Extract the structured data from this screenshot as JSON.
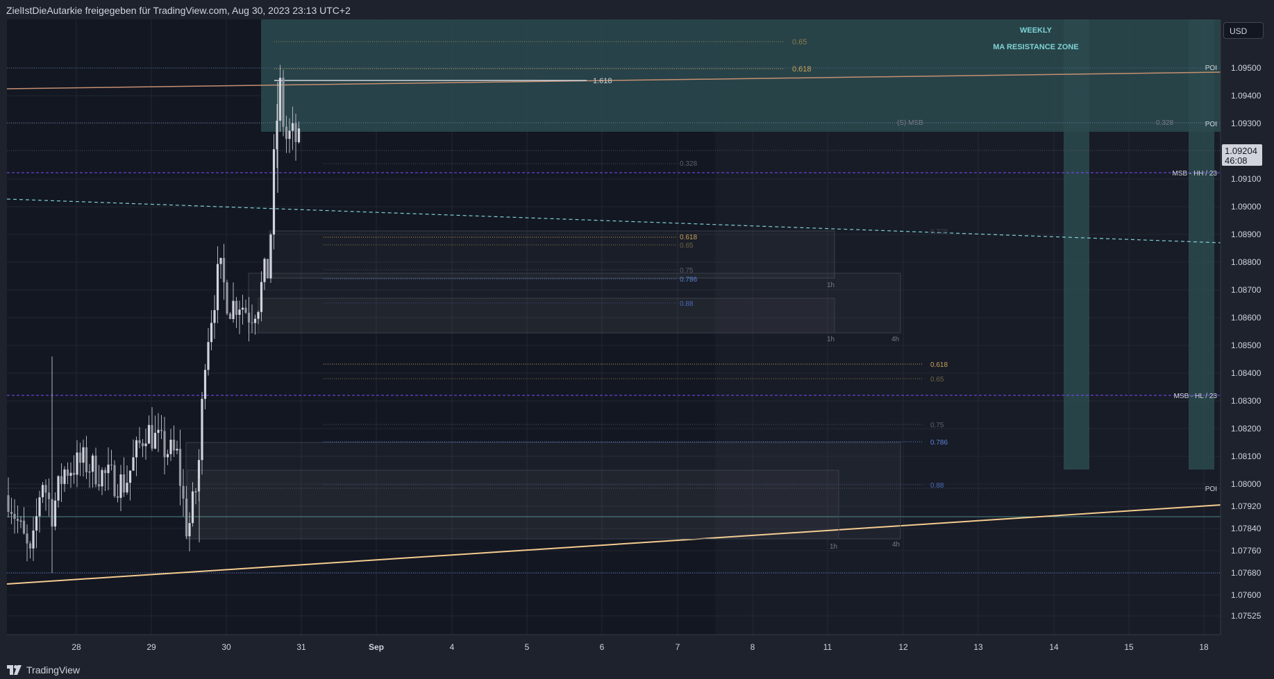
{
  "header": {
    "text": "ZielIstDieAutarkie freigegeben für TradingView.com, Aug 30, 2023 23:13 UTC+2"
  },
  "footer": {
    "logo_text": "TradingView"
  },
  "currency_button": "USD",
  "chart_data": {
    "type": "candlestick",
    "symbol_currency": "USD",
    "y_axis": {
      "min": 1.0749,
      "max": 1.0968,
      "ticks": [
        "1.09500",
        "1.09400",
        "1.09300",
        "1.09100",
        "1.09000",
        "1.08900",
        "1.08800",
        "1.08700",
        "1.08600",
        "1.08500",
        "1.08400",
        "1.08300",
        "1.08200",
        "1.08100",
        "1.08000",
        "1.07920",
        "1.07840",
        "1.07760",
        "1.07680",
        "1.07600",
        "1.07525"
      ]
    },
    "current_price": {
      "value": "1.09204",
      "countdown": "46:08"
    },
    "x_axis_ticks": [
      "28",
      "29",
      "30",
      "31",
      "Sep",
      "4",
      "5",
      "6",
      "7",
      "8",
      "11",
      "12",
      "13",
      "14",
      "15",
      "18"
    ],
    "zone_labels": [
      "WEEKLY",
      "MA RESISTANCE ZONE"
    ],
    "level_labels": {
      "poi_top": "POI",
      "poi_mid": "POI",
      "poi_low": "POI",
      "msb_hh": "MSB - HH / 23",
      "msb_hl": "MSB - HL / 23",
      "s_msb": "(S) MSB",
      "s_msb_value": "0.328"
    },
    "fib_top": {
      "f65": "0.65",
      "f618": "0.618",
      "f1618": "1.618"
    },
    "fib_mid": {
      "f328": "0.328",
      "f618": "0.618",
      "f65": "0.65",
      "f75": "0.75",
      "f786": "0.786",
      "f88": "0.88",
      "f328b": "0.328"
    },
    "fib_low": {
      "f618": "0.618",
      "f65": "0.65",
      "f75": "0.75",
      "f786": "0.786",
      "f88": "0.88"
    },
    "box_labels": {
      "upper_1h_a": "1h",
      "upper_1h_b": "1h",
      "upper_4h": "4h",
      "lower_1h": "1h",
      "lower_4h": "4h"
    },
    "colors": {
      "background": "#131722",
      "zone": "#2b4a4f",
      "candle": "#d1d4dc",
      "trend": "#f5cc8f",
      "ma": "#c79072",
      "dashed": "#7fd3d6",
      "purple": "#7c4dff",
      "fib_orange": "#c9a25a",
      "fib_blue": "#5b83d6"
    }
  }
}
